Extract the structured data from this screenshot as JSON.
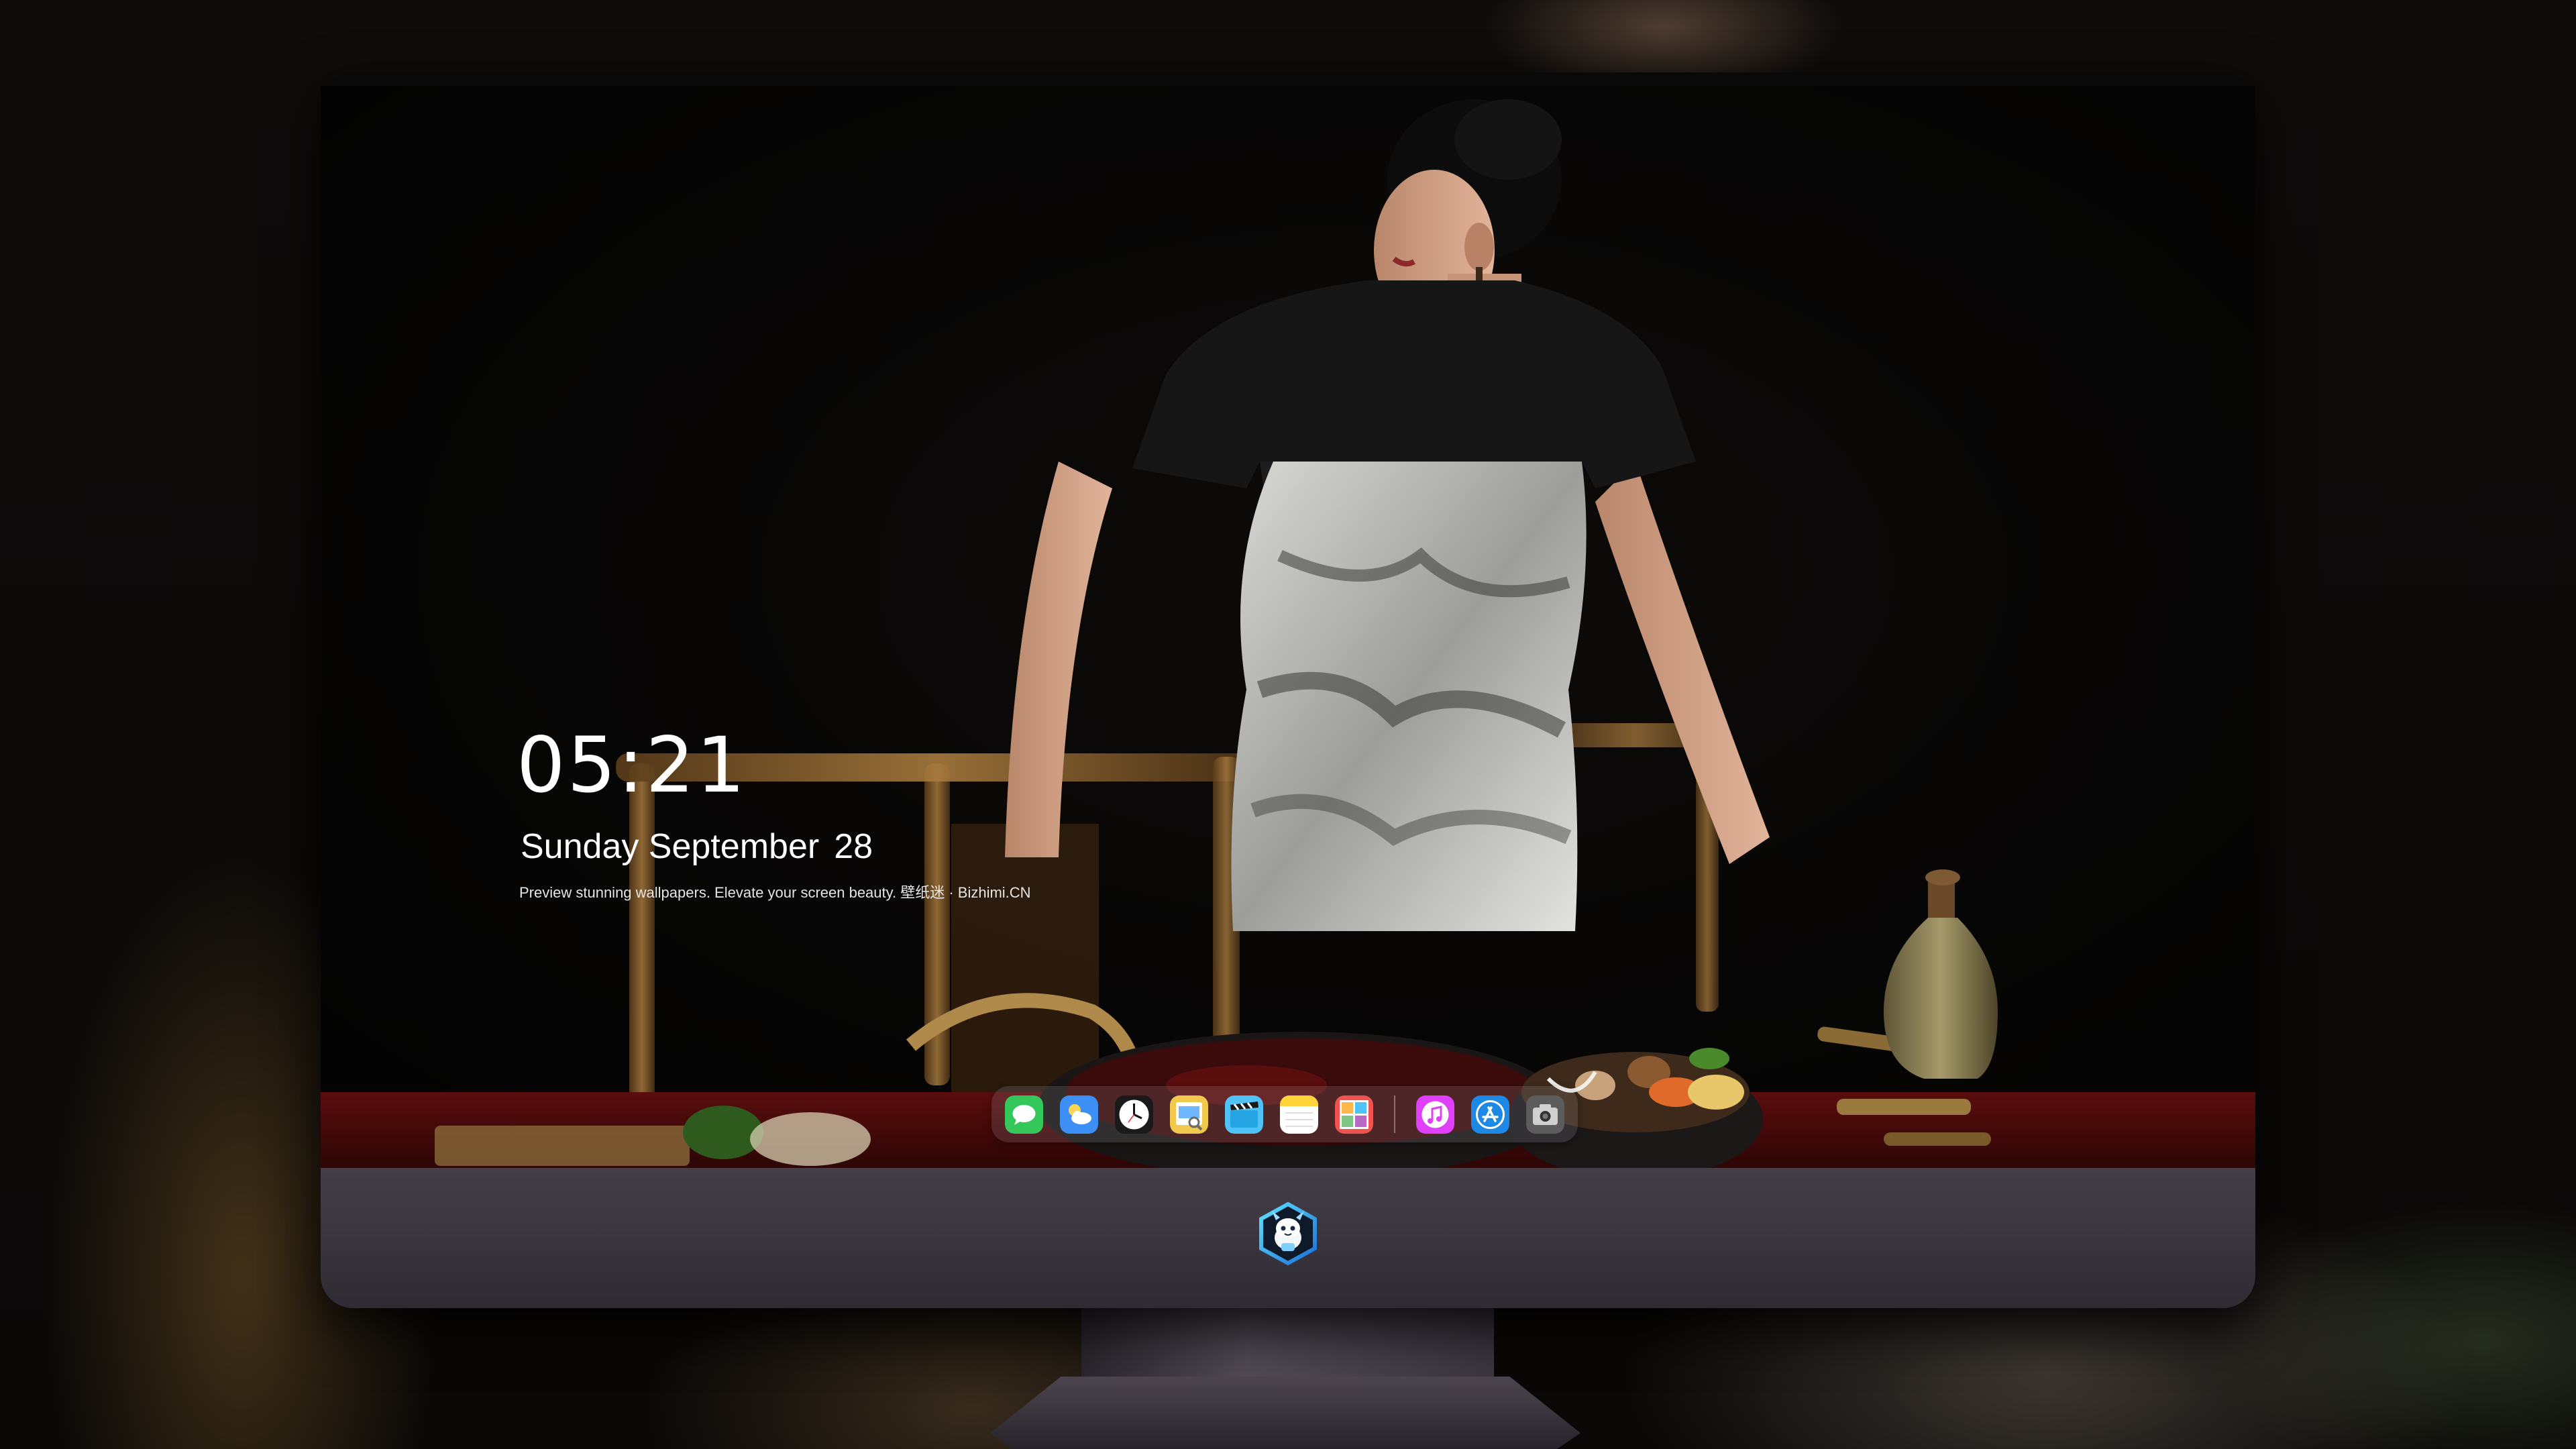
{
  "lockscreen": {
    "time": "05:21",
    "date_weekday_month": "Sunday September",
    "date_day": "28",
    "tagline": "Preview stunning wallpapers. Elevate your screen beauty. 壁纸迷 · Bizhimi.CN"
  },
  "dock": {
    "apps": [
      {
        "name": "Messages",
        "icon": "messages-icon",
        "color": "#34c759"
      },
      {
        "name": "Weather",
        "icon": "weather-icon",
        "color": "#3b8ff5"
      },
      {
        "name": "Clock",
        "icon": "clock-icon",
        "color": "#ffffff"
      },
      {
        "name": "Preview",
        "icon": "preview-icon",
        "color": "#f2c94c"
      },
      {
        "name": "Clips",
        "icon": "clips-icon",
        "color": "#4fc3f7"
      },
      {
        "name": "Notes",
        "icon": "notes-icon",
        "color": "#ffd43b"
      },
      {
        "name": "Photo Booth",
        "icon": "photo-booth-icon",
        "color": "#ef5350"
      },
      {
        "name": "iTunes",
        "icon": "itunes-icon",
        "color": "#e040fb"
      },
      {
        "name": "App Store",
        "icon": "app-store-icon",
        "color": "#1e88e5"
      },
      {
        "name": "Screenshot",
        "icon": "camera-icon",
        "color": "#9e9e9e"
      }
    ]
  },
  "monitor": {
    "logo": "dragon-mascot-logo",
    "bezel_color": "#3a353f"
  }
}
